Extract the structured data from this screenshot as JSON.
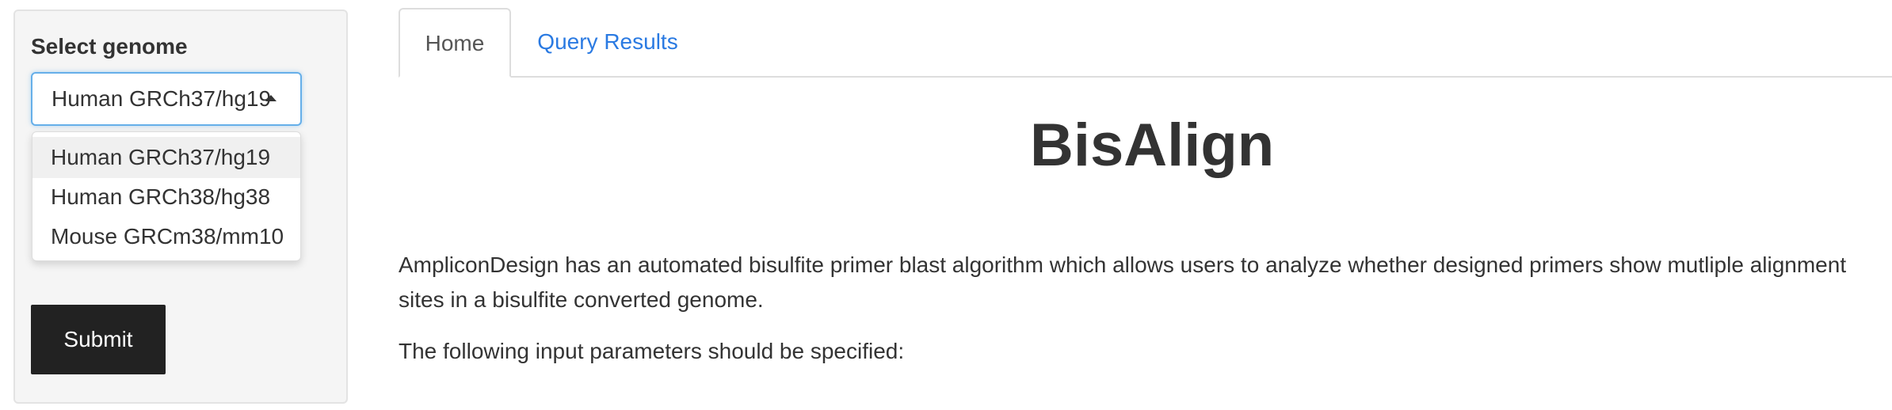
{
  "sidebar": {
    "select_label": "Select genome",
    "selected_value": "Human GRCh37/hg19",
    "options": [
      "Human GRCh37/hg19",
      "Human GRCh38/hg38",
      "Mouse GRCm38/mm10"
    ],
    "submit_label": "Submit"
  },
  "tabs": [
    {
      "label": "Home",
      "active": true
    },
    {
      "label": "Query Results",
      "active": false
    }
  ],
  "main": {
    "title": "BisAlign",
    "paragraph_1_line_1": "AmpliconDesign has an automated bisulfite primer blast algorithm which allows users to analyze whether designed primers show mutliple alignment",
    "paragraph_1_line_2": "sites in a bisulfite converted genome.",
    "paragraph_2": "The following input parameters should be specified:"
  },
  "colors": {
    "link": "#2a7ae2",
    "focus_border": "#66afe9",
    "button_bg": "#222222",
    "sidebar_bg": "#f5f5f5"
  }
}
